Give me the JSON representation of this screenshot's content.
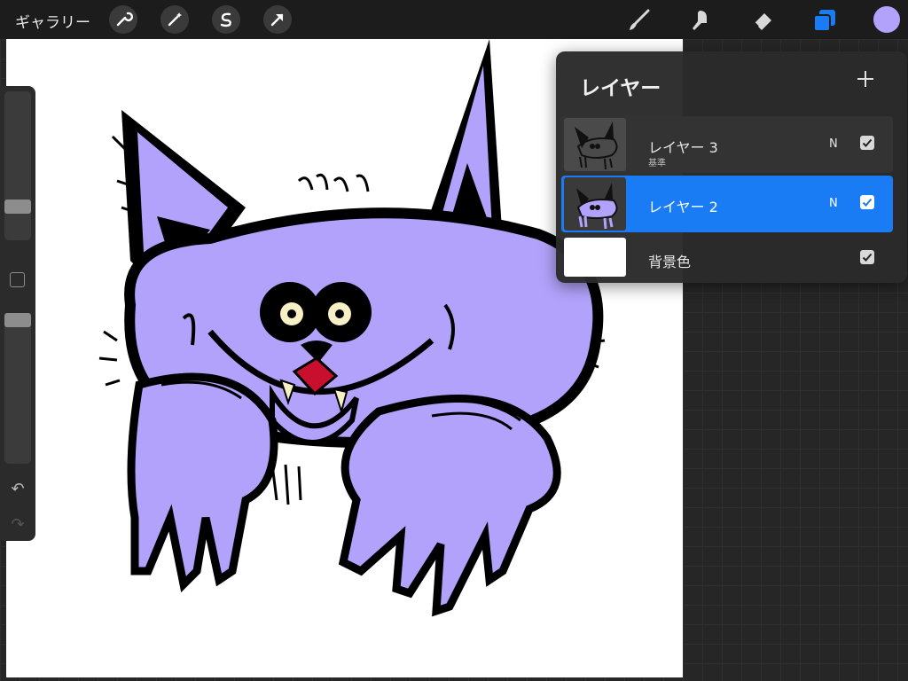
{
  "colors": {
    "accent": "#1a7cf5",
    "current_color": "#b3a2fb",
    "creature_fill": "#b3a2fb",
    "tongue": "#c8102e",
    "eyes": "#f6f0c4"
  },
  "topbar": {
    "gallery_label": "ギャラリー",
    "left_tools": [
      "wrench-icon",
      "magic-wand-icon",
      "selection-icon",
      "transform-arrow-icon"
    ],
    "right_tools": [
      "brush-icon",
      "smudge-icon",
      "eraser-icon",
      "layers-icon",
      "color-icon"
    ]
  },
  "sidebar": {
    "brush_size": 0.2,
    "opacity": 1.0,
    "undo_icon": "↶",
    "redo_icon": "↷"
  },
  "layers_panel": {
    "title": "レイヤー",
    "add_icon": "plus-icon",
    "layers": [
      {
        "name": "レイヤー 3",
        "sub": "基準",
        "blend": "N",
        "visible": true,
        "selected": false
      },
      {
        "name": "レイヤー 2",
        "sub": "",
        "blend": "N",
        "visible": true,
        "selected": true
      },
      {
        "name": "背景色",
        "sub": "",
        "blend": "",
        "visible": true,
        "selected": false
      }
    ]
  }
}
